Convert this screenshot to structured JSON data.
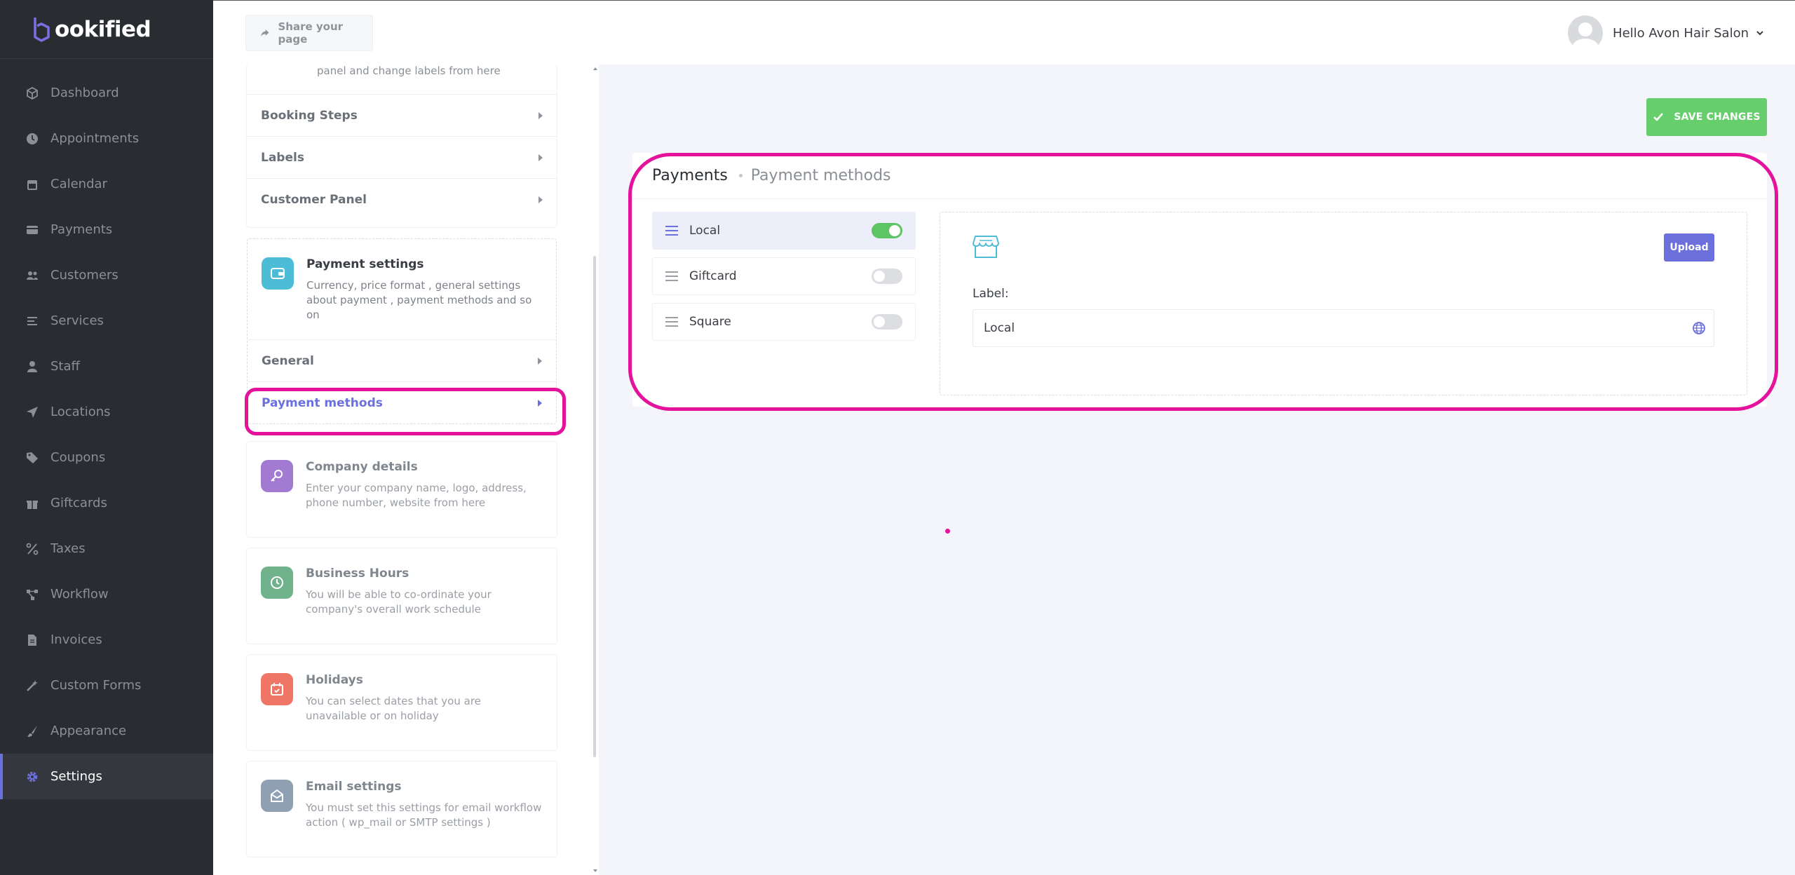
{
  "app": {
    "logo_text": "ookified"
  },
  "sidebar": {
    "items": [
      {
        "label": "Dashboard",
        "icon": "cube-icon"
      },
      {
        "label": "Appointments",
        "icon": "clock-icon"
      },
      {
        "label": "Calendar",
        "icon": "calendar-icon"
      },
      {
        "label": "Payments",
        "icon": "credit-card-icon"
      },
      {
        "label": "Customers",
        "icon": "users-icon"
      },
      {
        "label": "Services",
        "icon": "list-icon"
      },
      {
        "label": "Staff",
        "icon": "user-icon"
      },
      {
        "label": "Locations",
        "icon": "location-arrow-icon"
      },
      {
        "label": "Coupons",
        "icon": "tag-icon"
      },
      {
        "label": "Giftcards",
        "icon": "gift-icon"
      },
      {
        "label": "Taxes",
        "icon": "percent-icon"
      },
      {
        "label": "Workflow",
        "icon": "workflow-icon"
      },
      {
        "label": "Invoices",
        "icon": "file-icon"
      },
      {
        "label": "Custom Forms",
        "icon": "magic-wand-icon"
      },
      {
        "label": "Appearance",
        "icon": "paint-brush-icon"
      },
      {
        "label": "Settings",
        "icon": "gear-icon",
        "active": true
      }
    ]
  },
  "topbar": {
    "share_label": "Share your page",
    "user_greeting": "Hello Avon Hair Salon"
  },
  "settings_menu": {
    "top_card_text": "panel and change labels from here",
    "appearance_subitems": [
      "Booking Steps",
      "Labels",
      "Customer Panel"
    ],
    "payment_settings": {
      "title": "Payment settings",
      "desc": "Currency, price format , general settings about payment , payment methods and so on",
      "subitems": [
        "General",
        "Payment methods"
      ],
      "icon_color": "#4dbcd6"
    },
    "company_details": {
      "title": "Company details",
      "desc": "Enter your company name, logo, address, phone number, website from here",
      "icon_color": "#a27ad2"
    },
    "business_hours": {
      "title": "Business Hours",
      "desc": "You will be able to co-ordinate your company's overall work schedule",
      "icon_color": "#6fb28c"
    },
    "holidays": {
      "title": "Holidays",
      "desc": "You can select dates that you are unavailable or on holiday",
      "icon_color": "#ef7667"
    },
    "email_settings": {
      "title": "Email settings",
      "desc": "You must set this settings for email workflow action ( wp_mail or SMTP settings )",
      "icon_color": "#8fa0b2"
    }
  },
  "main": {
    "save_label": "SAVE CHANGES",
    "breadcrumb_title": "Payments",
    "breadcrumb_sub": "Payment methods",
    "methods": [
      {
        "label": "Local",
        "enabled": true
      },
      {
        "label": "Giftcard",
        "enabled": false
      },
      {
        "label": "Square",
        "enabled": false
      }
    ],
    "upload_label": "Upload",
    "label_caption": "Label:",
    "label_value": "Local"
  },
  "colors": {
    "accent": "#6c70dc",
    "success": "#66cf6c",
    "highlight": "#e5129c",
    "sidebar_bg": "#292d32"
  }
}
